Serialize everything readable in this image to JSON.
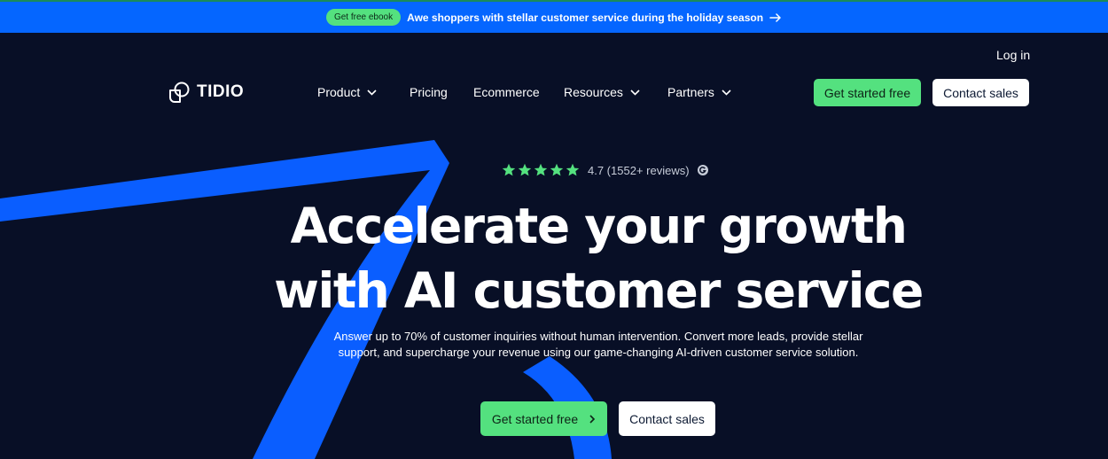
{
  "banner": {
    "pill": "Get free ebook",
    "text": "Awe shoppers with stellar customer service during the holiday season"
  },
  "header": {
    "login": "Log in",
    "logo_text": "TIDIO",
    "nav": {
      "product": "Product",
      "pricing": "Pricing",
      "ecommerce": "Ecommerce",
      "resources": "Resources",
      "partners": "Partners"
    },
    "get_started": "Get started free",
    "contact_sales": "Contact sales"
  },
  "hero": {
    "rating": "4.7 (1552+ reviews)",
    "stars": 5,
    "headline_line1": "Accelerate your growth",
    "headline_line2": "with AI customer service",
    "subline1": "Answer up to 70% of customer inquiries without human intervention. Convert more leads, provide stellar",
    "subline2": "support, and supercharge your revenue using our game-changing AI-driven customer service solution.",
    "cta_primary": "Get started free",
    "cta_secondary": "Contact sales"
  },
  "colors": {
    "background": "#080f26",
    "banner": "#0566ff",
    "accent_green": "#54e17f",
    "swirl_blue": "#0a5eff"
  },
  "icons": [
    "arrow-right-icon",
    "tidio-logo-icon",
    "chevron-down-icon",
    "star-icon",
    "g2-icon",
    "chevron-right-icon"
  ]
}
